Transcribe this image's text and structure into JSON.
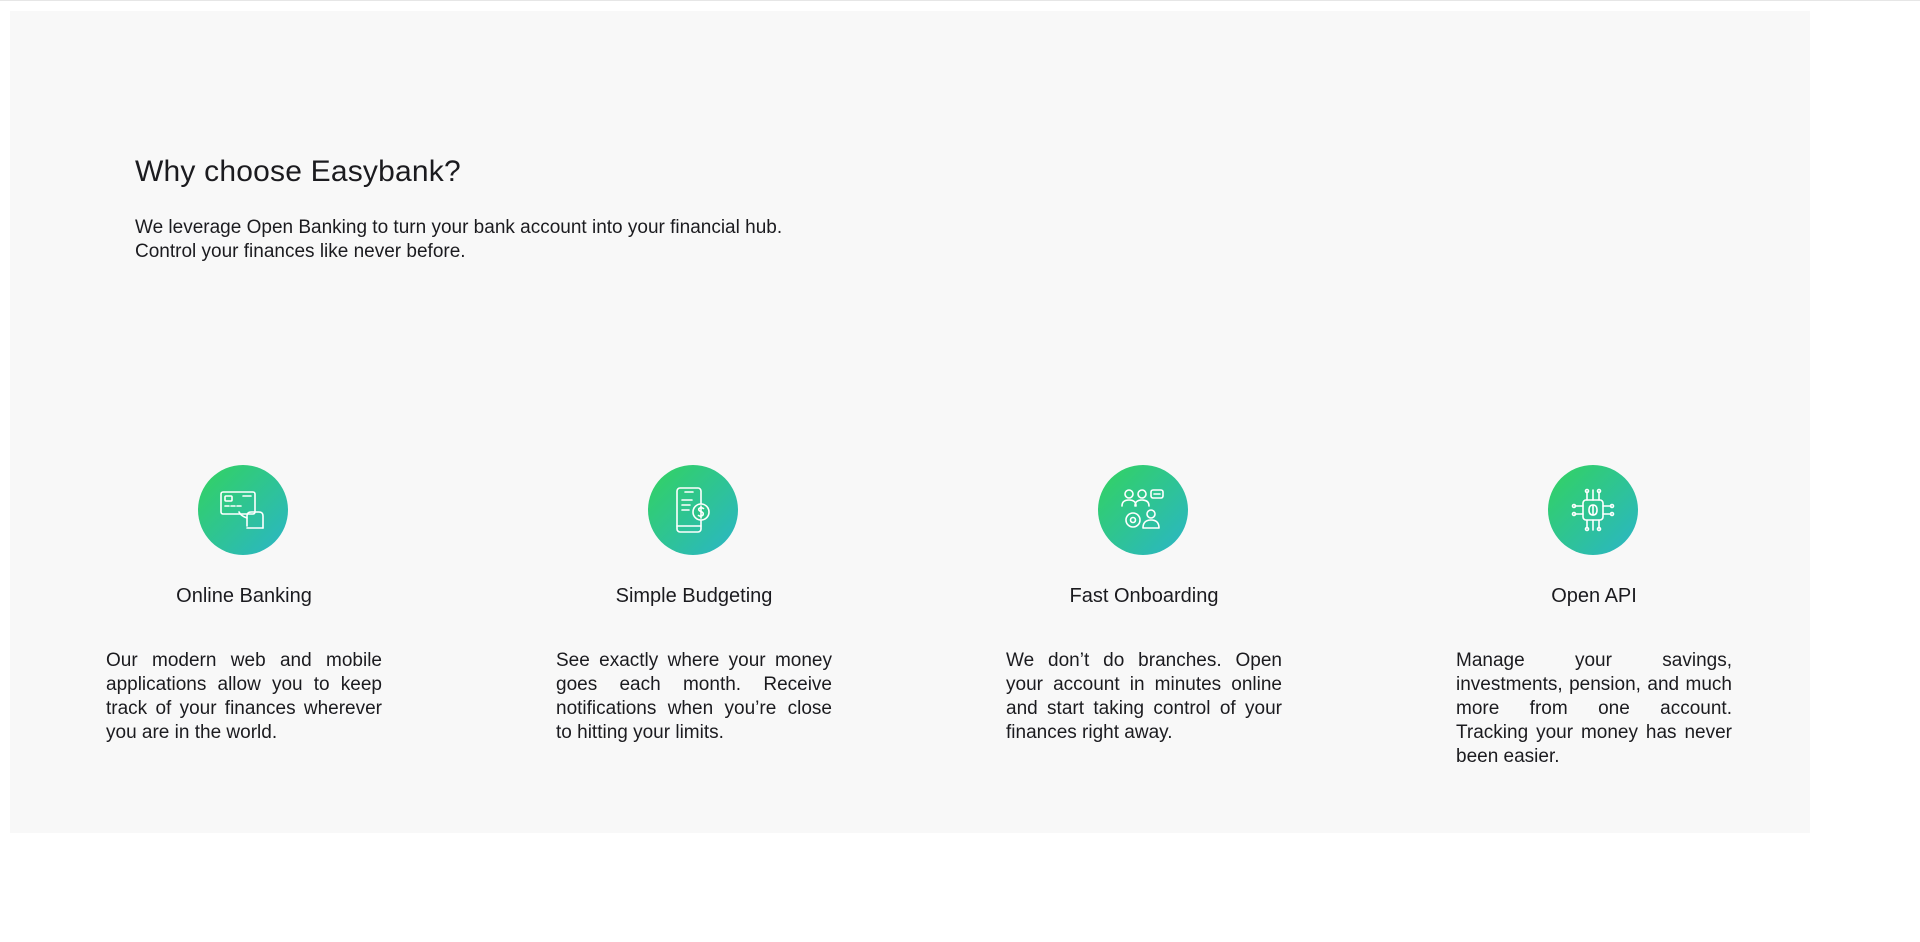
{
  "section": {
    "heading": "Why choose Easybank?",
    "intro_line1": "We leverage Open Banking to turn your bank account into your financial hub.",
    "intro_line2": "Control your finances like never before."
  },
  "colors": {
    "panel_background": "#f8f8f8",
    "text": "#1b1b1f",
    "icon_gradient_start": "#33d35e",
    "icon_gradient_end": "#2ab5c8"
  },
  "features": [
    {
      "icon": "online-banking-icon",
      "title": "Online Banking",
      "description": "Our modern web and mobile applications allow you to keep track of your finances wherever you are in the world."
    },
    {
      "icon": "budgeting-icon",
      "title": "Simple Budgeting",
      "description": "See exactly where your money goes each month. Receive notifications when you’re close to hitting your limits."
    },
    {
      "icon": "onboarding-icon",
      "title": "Fast Onboarding",
      "description": "We don’t do branches. Open your account in minutes online and start taking control of your finances right away."
    },
    {
      "icon": "api-icon",
      "title": "Open API",
      "description": "Manage your savings, investments, pension, and much more from one account. Tracking your money has never been easier."
    }
  ]
}
